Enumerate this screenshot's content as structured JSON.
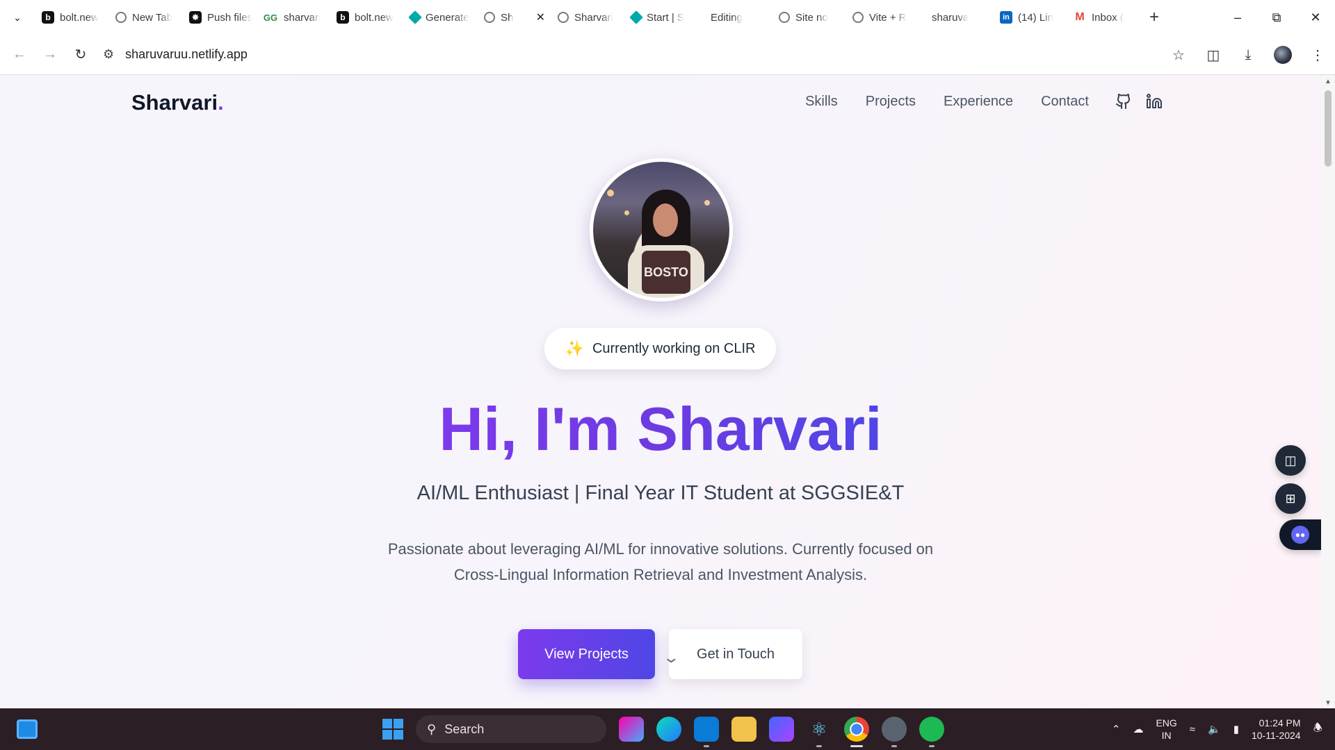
{
  "browser": {
    "tabs": [
      {
        "title": "bolt.new",
        "icon": "bolt-icon"
      },
      {
        "title": "New Tab",
        "icon": "chrome-icon"
      },
      {
        "title": "Push files",
        "icon": "openai-icon"
      },
      {
        "title": "sharvari",
        "icon": "geeksforgeeks-icon"
      },
      {
        "title": "bolt.new",
        "icon": "bolt-icon"
      },
      {
        "title": "Generate",
        "icon": "diamond-icon"
      },
      {
        "title": "Sh",
        "icon": "globe-icon",
        "active": true
      },
      {
        "title": "Sharvari",
        "icon": "globe-icon"
      },
      {
        "title": "Start | S",
        "icon": "diamond-icon"
      },
      {
        "title": "Editing",
        "icon": "none"
      },
      {
        "title": "Site no",
        "icon": "globe-icon"
      },
      {
        "title": "Vite + R",
        "icon": "globe-icon"
      },
      {
        "title": "sharuva",
        "icon": "none"
      },
      {
        "title": "(14) Lin",
        "icon": "linkedin-icon"
      },
      {
        "title": "Inbox (",
        "icon": "gmail-icon"
      }
    ],
    "url": "sharuvaruu.netlify.app"
  },
  "site": {
    "brand": "Sharvari",
    "brand_dot": ".",
    "nav": [
      "Skills",
      "Projects",
      "Experience",
      "Contact"
    ],
    "badge": "Currently working on CLIR",
    "photo_text": "BOSTO",
    "hero_title": "Hi, I'm Sharvari",
    "hero_subtitle": "AI/ML Enthusiast | Final Year IT Student at SGGSIE&T",
    "hero_desc_1": "Passionate about leveraging AI/ML for innovative solutions. Currently focused on",
    "hero_desc_2": "Cross-Lingual Information Retrieval and Investment Analysis.",
    "btn_primary": "View Projects",
    "btn_secondary": "Get in Touch",
    "accent": "#7c3aed",
    "accent_2": "#4f46e5"
  },
  "taskbar": {
    "search_placeholder": "Search",
    "lang_1": "ENG",
    "lang_2": "IN",
    "time": "01:24 PM",
    "date": "10-11-2024"
  }
}
